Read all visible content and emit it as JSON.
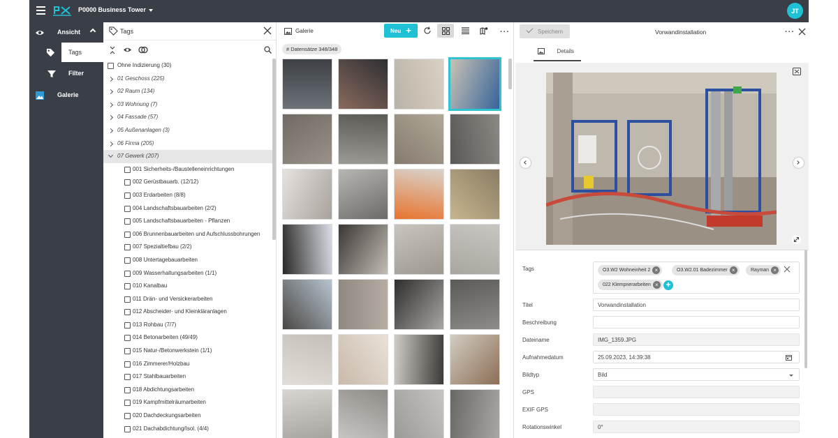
{
  "topbar": {
    "project_name": "P0000 Business Tower",
    "user_initials": "JT"
  },
  "leftnav": {
    "ansicht": "Ansicht",
    "tags": "Tags",
    "filter": "Filter",
    "galerie": "Galerie"
  },
  "tags_panel": {
    "title": "Tags",
    "items": [
      {
        "label": "Ohne Indizierung (30)",
        "level": 0,
        "type": "checkbox"
      },
      {
        "label": "01 Geschoss (225)",
        "level": 0,
        "type": "group"
      },
      {
        "label": "02 Raum (134)",
        "level": 0,
        "type": "group"
      },
      {
        "label": "03 Wohnung (7)",
        "level": 0,
        "type": "group"
      },
      {
        "label": "04 Fassade (57)",
        "level": 0,
        "type": "group"
      },
      {
        "label": "05 Außenanlagen (3)",
        "level": 0,
        "type": "group"
      },
      {
        "label": "06 Firma (205)",
        "level": 0,
        "type": "group"
      },
      {
        "label": "07 Gewerk (207)",
        "level": 0,
        "type": "group-open"
      },
      {
        "label": "001 Sicherheits-/Baustelleneinrichtungen",
        "level": 1
      },
      {
        "label": "002 Gerüstbauarb. (12/12)",
        "level": 1
      },
      {
        "label": "003 Erdarbeiten (8/8)",
        "level": 1
      },
      {
        "label": "004 Landschaftsbauarbeiten (2/2)",
        "level": 1
      },
      {
        "label": "005 Landschaftsbauarbeiten - Pflanzen",
        "level": 1
      },
      {
        "label": "006 Brunnenbauarbeiten und Aufschlussbohrungen",
        "level": 1
      },
      {
        "label": "007 Spezialtiefbau (2/2)",
        "level": 1
      },
      {
        "label": "008 Untertagebauarbeiten",
        "level": 1
      },
      {
        "label": "009 Wasserhaltungsarbeiten (1/1)",
        "level": 1
      },
      {
        "label": "010 Kanalbau",
        "level": 1
      },
      {
        "label": "011 Drän- und Versickerarbeiten",
        "level": 1
      },
      {
        "label": "012 Abscheider- und Kleinkläranlagen",
        "level": 1
      },
      {
        "label": "013 Rohbau (7/7)",
        "level": 1
      },
      {
        "label": "014 Betonarbeiten (49/49)",
        "level": 1
      },
      {
        "label": "015 Natur-/Betonwerkstein (1/1)",
        "level": 1
      },
      {
        "label": "016 Zimmerer/Holzbau",
        "level": 1
      },
      {
        "label": "017 Stahlbauarbeiten",
        "level": 1
      },
      {
        "label": "018 Abdichtungsarbeiten",
        "level": 1
      },
      {
        "label": "019 Kampfmittelräumarbeiten",
        "level": 1
      },
      {
        "label": "020 Dachdeckungsarbeiten",
        "level": 1
      },
      {
        "label": "021 Dachabdichtung/Isol. (4/4)",
        "level": 1
      }
    ]
  },
  "gallery": {
    "title": "Galerie",
    "new_label": "Neu",
    "count_chip": "# Datensätze 348/348",
    "thumbs": [
      {
        "c": "#6d7278",
        "c2": "#3d4146"
      },
      {
        "c": "#8a6a5c",
        "c2": "#2e2f33"
      },
      {
        "c": "#b9b2a6",
        "c2": "#d9d2c4"
      },
      {
        "c": "#c9c2b4",
        "c2": "#37649b"
      },
      {
        "c": "#706a64",
        "c2": "#9a9288"
      },
      {
        "c": "#9c9a95",
        "c2": "#5c5a55"
      },
      {
        "c": "#857a6e",
        "c2": "#b1a898"
      },
      {
        "c": "#5a5856",
        "c2": "#8c8884"
      },
      {
        "c": "#e6e2de",
        "c2": "#a7a29c"
      },
      {
        "c": "#b8b6b3",
        "c2": "#6c6a67"
      },
      {
        "c": "#e8742e",
        "c2": "#d8d3cc"
      },
      {
        "c": "#c7b58e",
        "c2": "#8a7d64"
      },
      {
        "c": "#2a2826",
        "c2": "#d9dde4"
      },
      {
        "c": "#3a3632",
        "c2": "#c2bdb6"
      },
      {
        "c": "#c9c5be",
        "c2": "#9c978f"
      },
      {
        "c": "#a9a6a0",
        "c2": "#c9c6c1"
      },
      {
        "c": "#4a4744",
        "c2": "#b7c4cf"
      },
      {
        "c": "#8f8880",
        "c2": "#b5ada2"
      },
      {
        "c": "#2f2d2b",
        "c2": "#a7a6a5"
      },
      {
        "c": "#5c5a57",
        "c2": "#8e8c88"
      },
      {
        "c": "#e2ddd8",
        "c2": "#c4bfb8"
      },
      {
        "c": "#c9b9aa",
        "c2": "#e9e1d8"
      },
      {
        "c": "#d0ccc6",
        "c2": "#3b3936"
      },
      {
        "c": "#d2ccc2",
        "c2": "#8c6e55"
      },
      {
        "c": "#d8d5d1",
        "c2": "#a6a39e"
      },
      {
        "c": "#c8c6c3",
        "c2": "#8e8b87"
      },
      {
        "c": "#9c9a96",
        "c2": "#c6c4c1"
      },
      {
        "c": "#6a6864",
        "c2": "#a9a7a3"
      }
    ]
  },
  "detail": {
    "save_label": "Speichern",
    "title": "Vorwandinstallation",
    "tab_details": "Details",
    "fields": {
      "tags_label": "Tags",
      "tags": [
        "O3.W2 Wohneinheit 2",
        "O3.W2.01 Badezimmer",
        "Rayman",
        "022 Klempnerarbeiten"
      ],
      "titel_label": "Titel",
      "titel_value": "Vorwandinstallation",
      "beschreibung_label": "Beschreibung",
      "beschreibung_value": "",
      "dateiname_label": "Dateiname",
      "dateiname_value": "IMG_1359.JPG",
      "aufnahmedatum_label": "Aufnahmedatum",
      "aufnahmedatum_value": "25.09.2023, 14:39:38",
      "bildtyp_label": "Bildtyp",
      "bildtyp_value": "Bild",
      "gps_label": "GPS",
      "gps_value": "",
      "exif_gps_label": "EXIF GPS",
      "exif_gps_value": "",
      "rotation_label": "Rotationswinkel",
      "rotation_value": "0°"
    }
  },
  "colors": {
    "accent": "#1fc1d4",
    "nav_bg": "#3a3f47",
    "selection": "#2ec3cf"
  },
  "icons": [
    "menu-icon",
    "logo-icon",
    "eye-icon",
    "tag-icon",
    "filter-icon",
    "image-icon",
    "close-icon",
    "collapse-icon",
    "eye-icon",
    "toggle-icon",
    "search-icon",
    "plus-icon",
    "refresh-icon",
    "grid-icon",
    "list-icon",
    "map-icon",
    "more-icon",
    "check-icon",
    "fullscreen-icon",
    "expand-icon",
    "chevron-left-icon",
    "chevron-right-icon",
    "calendar-icon",
    "dropdown-icon"
  ]
}
